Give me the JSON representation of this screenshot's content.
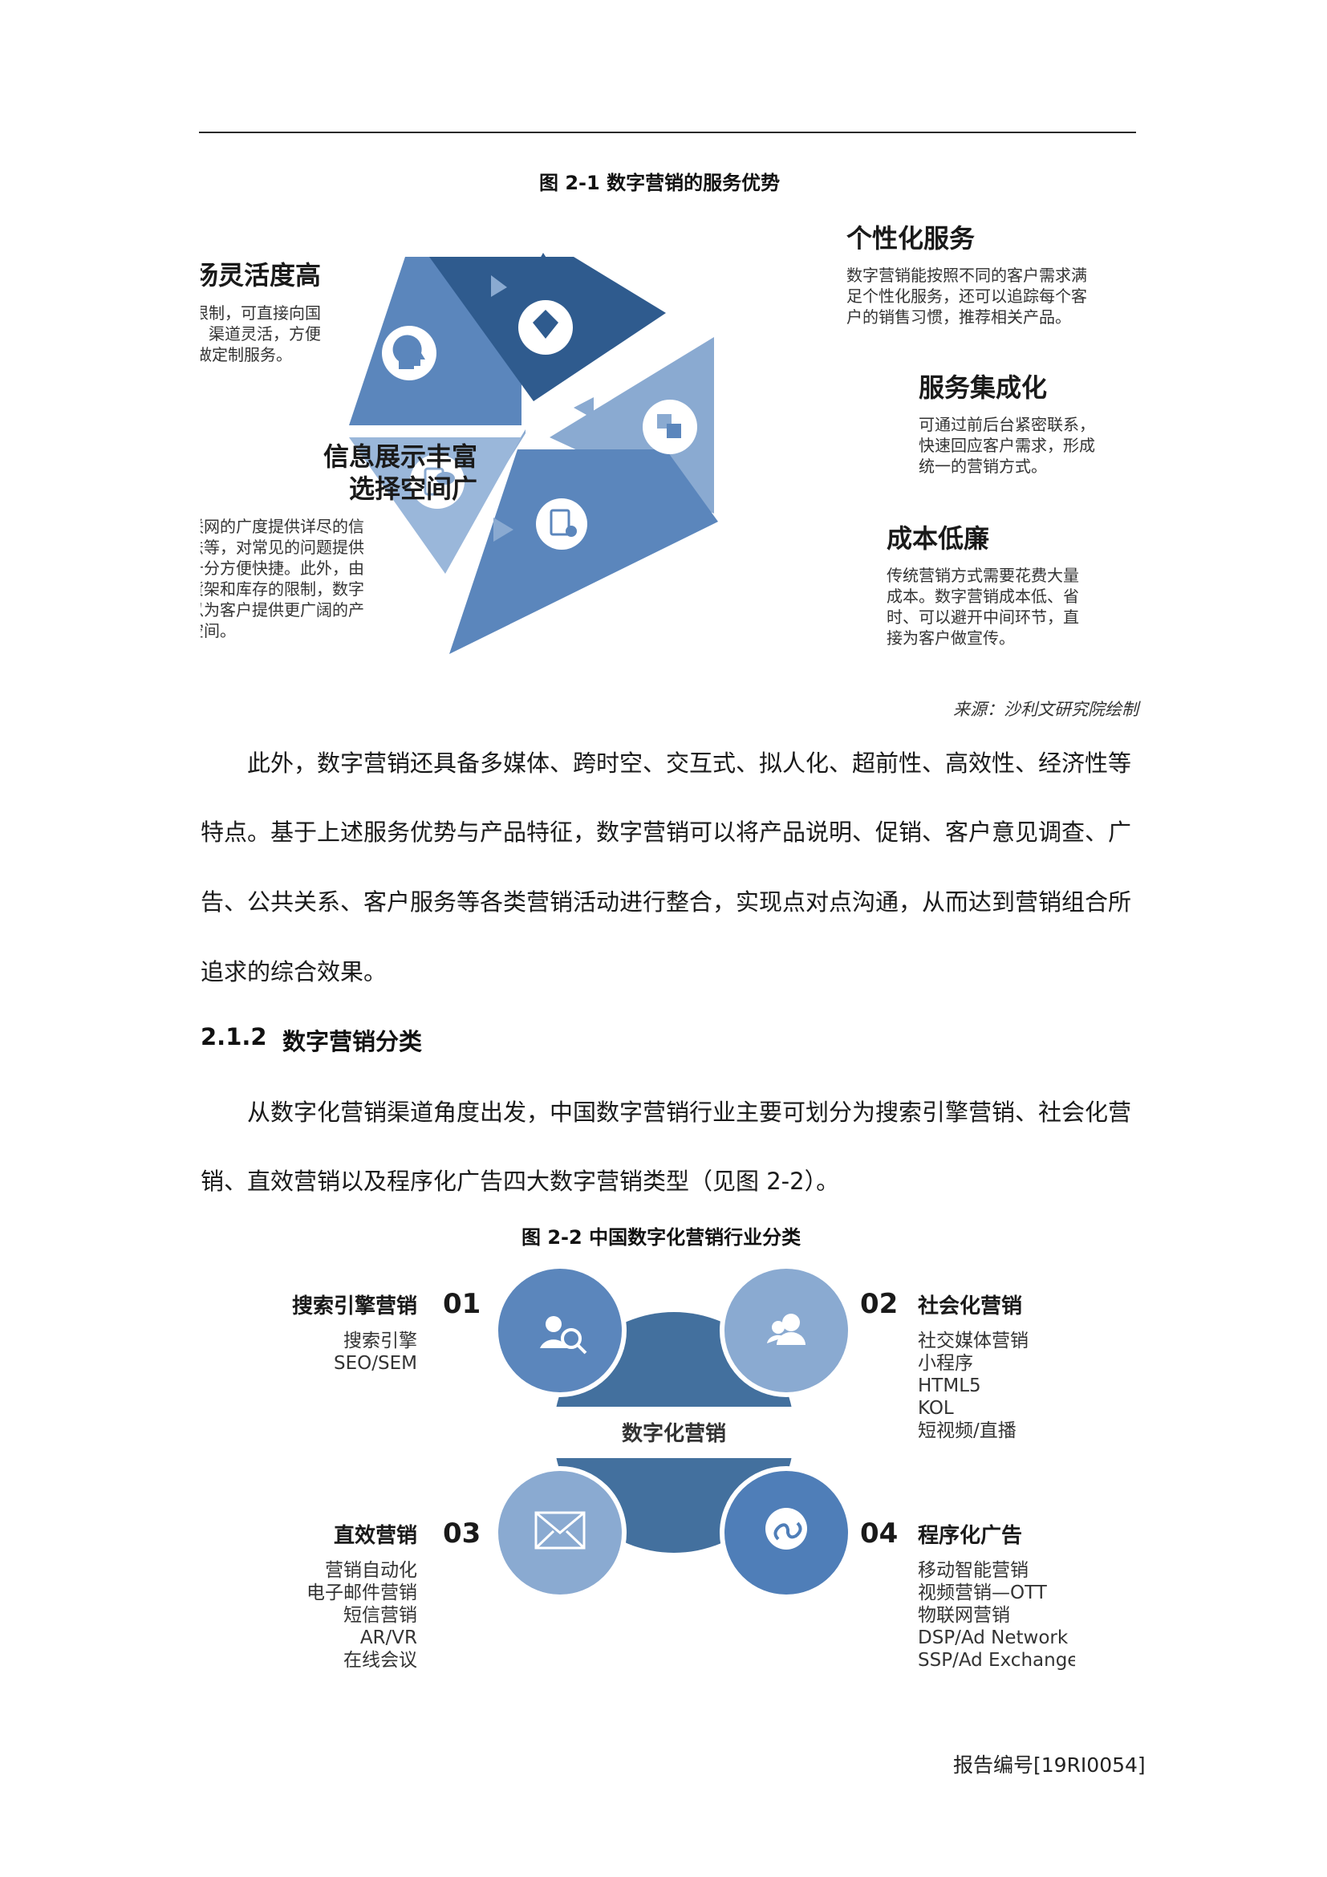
{
  "fig1": {
    "title": "图 2-1  数字营销的服务优势",
    "items": [
      {
        "title": "市场灵活度高",
        "desc": [
          "地域方面不受限制，可直接向国",
          "外宣传。产品，渠道灵活，方便",
          "为客户做定制服务。"
        ]
      },
      {
        "title": "个性化服务",
        "desc": [
          "数字营销能按照不同的客户需求满",
          "足个性化服务，还可以追踪每个客",
          "户的销售习惯，推荐相关产品。"
        ]
      },
      {
        "title": "服务集成化",
        "desc": [
          "可通过前后台紧密联系，",
          "快速回应客户需求，形成",
          "统一的营销方式。"
        ]
      },
      {
        "title": "信息展示丰富",
        "title2": "选择空间广",
        "desc": [
          "利用互联网的广度提供详尽的信",
          "息和方法等，对常见的问题提供",
          "解答。十分方便快捷。此外，由",
          "于不受货架和库存的限制，数字",
          "营销可以为客户提供更广阔的产",
          "品展示空间。"
        ]
      },
      {
        "title": "成本低廉",
        "desc": [
          "传统营销方式需要花费大量",
          "成本。数字营销成本低、省",
          "时、可以避开中间环节，直",
          "接为客户做宣传。"
        ]
      }
    ],
    "source": "来源：沙利文研究院绘制"
  },
  "paragraph1": [
    "此外，数字营销还具备多媒体、跨时空、交互式、拟人化、超前性、高效性、经济性等",
    "特点。基于上述服务优势与产品特征，数字营销可以将产品说明、促销、客户意见调查、广",
    "告、公共关系、客户服务等各类营销活动进行整合，实现点对点沟通，从而达到营销组合所",
    "追求的综合效果。"
  ],
  "section": {
    "number": "2.1.2",
    "title": "数字营销分类"
  },
  "paragraph2": [
    "从数字化营销渠道角度出发，中国数字营销行业主要可划分为搜索引擎营销、社会化营",
    "销、直效营销以及程序化广告四大数字营销类型（见图 2-2）。"
  ],
  "fig2": {
    "title": "图 2-2  中国数字化营销行业分类",
    "center": "数字化营销",
    "quadrants": [
      {
        "num": "01",
        "title": "搜索引擎营销",
        "items": [
          "搜索引擎",
          "SEO/SEM"
        ]
      },
      {
        "num": "02",
        "title": "社会化营销",
        "items": [
          "社交媒体营销",
          "小程序",
          "HTML5",
          "KOL",
          "短视频/直播"
        ]
      },
      {
        "num": "03",
        "title": "直效营销",
        "items": [
          "营销自动化",
          "电子邮件营销",
          "短信营销",
          "AR/VR",
          "在线会议"
        ]
      },
      {
        "num": "04",
        "title": "程序化广告",
        "items": [
          "移动智能营销",
          "视频营销—OTT",
          "物联网营销",
          "DSP/Ad Network",
          "SSP/Ad Exchange"
        ]
      }
    ]
  },
  "footer": "报告编号[19RI0054]"
}
